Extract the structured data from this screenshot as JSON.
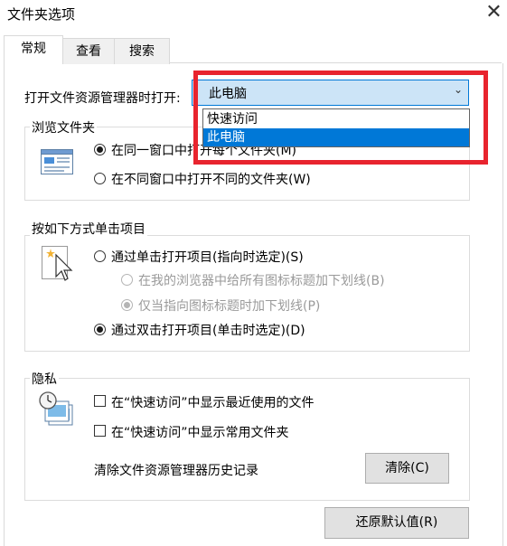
{
  "window": {
    "title": "文件夹选项",
    "close_symbol": "✕"
  },
  "tabs": [
    {
      "label": "常规",
      "active": true
    },
    {
      "label": "查看",
      "active": false
    },
    {
      "label": "搜索",
      "active": false
    }
  ],
  "open_explorer": {
    "label": "打开文件资源管理器时打开:",
    "selected": "此电脑",
    "chevron": "⌄",
    "options": [
      {
        "label": "快速访问",
        "selected": false
      },
      {
        "label": "此电脑",
        "selected": true
      }
    ]
  },
  "browse_folders": {
    "title": "浏览文件夹",
    "options": [
      {
        "label": "在同一窗口中打开每个文件夹(M)",
        "checked": true
      },
      {
        "label": "在不同窗口中打开不同的文件夹(W)",
        "checked": false
      }
    ]
  },
  "click_items": {
    "title": "按如下方式单击项目",
    "single_click": {
      "label": "通过单击打开项目(指向时选定)(S)",
      "checked": false
    },
    "underline_all": {
      "label": "在我的浏览器中给所有图标标题加下划线(B)",
      "checked": false,
      "disabled": true
    },
    "underline_point": {
      "label": "仅当指向图标标题时加下划线(P)",
      "checked": true,
      "disabled": true
    },
    "double_click": {
      "label": "通过双击打开项目(单击时选定)(D)",
      "checked": true
    }
  },
  "privacy": {
    "title": "隐私",
    "show_recent": {
      "label": "在“快速访问”中显示最近使用的文件",
      "checked": false
    },
    "show_frequent": {
      "label": "在“快速访问”中显示常用文件夹",
      "checked": false
    },
    "clear_history_label": "清除文件资源管理器历史记录",
    "clear_button": "清除(C)"
  },
  "restore_defaults_button": "还原默认值(R)",
  "colors": {
    "selection_blue": "#0078d7",
    "combo_bg": "#cce4f7",
    "highlight_red": "#e8242e"
  }
}
